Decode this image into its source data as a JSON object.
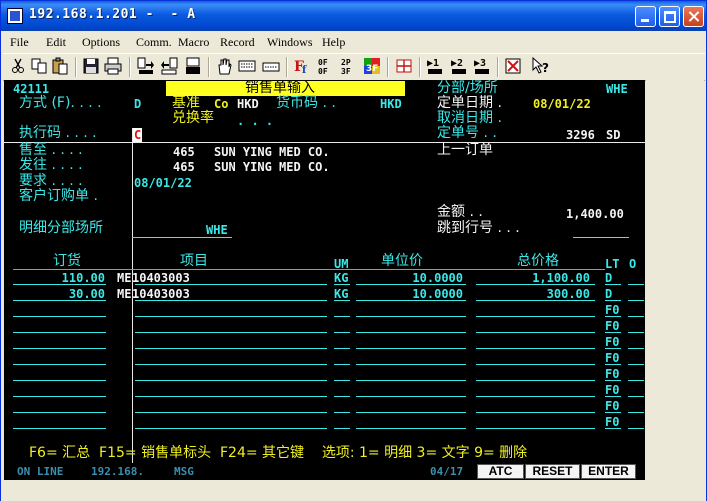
{
  "window": {
    "title": "192.168.1.201 -  - A"
  },
  "menu": [
    "File",
    "Edit",
    "Options",
    "Comm.",
    "Macro",
    "Record",
    "Windows",
    "Help"
  ],
  "toolbar_icons": [
    "cut-icon",
    "copy-icon",
    "paste-icon",
    "save-icon",
    "print-icon",
    "send-file-icon",
    "receive-file-icon",
    "transfer-icon",
    "hand-icon",
    "keyboard-icon",
    "keypad-icon",
    "font-icon",
    "off-icon",
    "3270-icon",
    "color-icon",
    "grid-icon",
    "macro1-icon",
    "macro2-icon",
    "macro3-icon",
    "stop-icon",
    "help-icon"
  ],
  "screen": {
    "program_id": "42111",
    "screen_title": "销售单输入",
    "branch_label": "分部/场所",
    "branch_value": "WHE",
    "method_label": "方式 (F). . . .",
    "method_value": "D",
    "basis_label": "基准",
    "co_label": "Co",
    "co_value": "HKD",
    "currency_label": "货币码 . .",
    "currency_value": "HKD",
    "order_date_label": "定单日期 .",
    "order_date_value": "08/01/22",
    "exchange_label": "兑换率",
    "exchange_dots": ". . .",
    "cancel_date_label": "取消日期 .",
    "exec_code_label": "执行码 . . . .",
    "exec_code_value": "C",
    "order_no_label": "定单号 . .",
    "order_no_value": "3296",
    "order_type": "SD",
    "sold_to_label": "售至 . . . .",
    "sold_to_no": "465",
    "sold_to_name": "SUN YING MED CO.",
    "prev_order_label": "上一订单",
    "ship_to_label": "发往 . . . .",
    "ship_to_no": "465",
    "ship_to_name": "SUN YING MED CO.",
    "request_label": "要求 . . . .",
    "request_value": "08/01/22",
    "cust_po_label": "客户订购单 .",
    "amount_label": "金额 . .",
    "amount_value": "1,400.00",
    "detail_branch_label": "明细分部场所",
    "detail_branch_value": "WHE",
    "jump_label": "跳到行号 . . .",
    "grid_headers": {
      "qty": "订货",
      "item": "项目",
      "um": "UM",
      "unit_price": "单位价",
      "ext_price": "总价格",
      "lt": "LT",
      "o": "O"
    },
    "rows": [
      {
        "qty": "110.00",
        "pre": "ME",
        "item": "10403003",
        "um": "KG",
        "unit_price": "10.0000",
        "ext_price": "1,100.00",
        "lt": "D"
      },
      {
        "qty": "30.00",
        "pre": "ME",
        "item": "10403003",
        "um": "KG",
        "unit_price": "10.0000",
        "ext_price": "300.00",
        "lt": "D"
      },
      {
        "lt": "F0"
      },
      {
        "lt": "F0"
      },
      {
        "lt": "F0"
      },
      {
        "lt": "F0"
      },
      {
        "lt": "F0"
      },
      {
        "lt": "F0"
      },
      {
        "lt": "F0"
      },
      {
        "lt": "F0"
      }
    ],
    "fkeys": "F6= 汇总  F15= 销售单标头  F24= 其它键    选项: 1= 明细 3= 文字 9= 删除"
  },
  "status": {
    "online": "ON LINE",
    "host": "192.168.",
    "msg": "MSG",
    "cursor": "04/17",
    "buttons": [
      "ATC",
      "RESET",
      "ENTER"
    ]
  }
}
